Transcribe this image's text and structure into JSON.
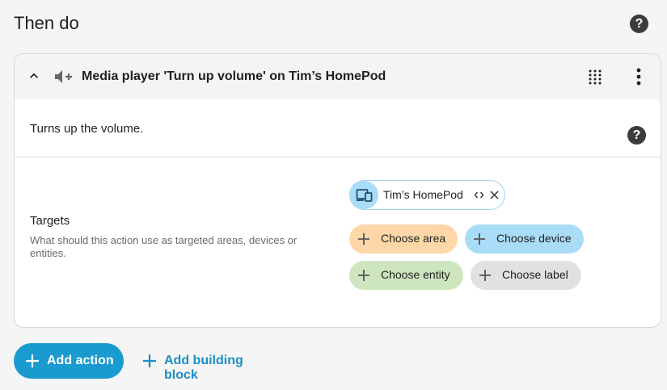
{
  "section": {
    "title": "Then do",
    "help_glyph": "?"
  },
  "action_card": {
    "title": "Media player 'Turn up volume' on Tim’s HomePod",
    "description": "Turns up the volume.",
    "help_glyph": "?",
    "icons": {
      "collapse": "chevron-up-icon",
      "action_type": "volume-up-icon",
      "drag": "drag-handle-icon",
      "menu": "more-vertical-icon"
    },
    "targets": {
      "label": "Targets",
      "helper": "What should this action use as targeted areas, devices or entities.",
      "selected": [
        {
          "label": "Tim’s HomePod",
          "icon": "device-icon"
        }
      ],
      "choose_area": "Choose area",
      "choose_device": "Choose device",
      "choose_entity": "Choose entity",
      "choose_label": "Choose label"
    }
  },
  "footer": {
    "add_action": "Add action",
    "add_building_block": "Add building block"
  },
  "colors": {
    "accent": "#1a9bd0",
    "area_chip": "#fdd7a7",
    "device_chip": "#a9dcf6",
    "entity_chip": "#cde6bf",
    "label_chip": "#e1e1e1"
  }
}
